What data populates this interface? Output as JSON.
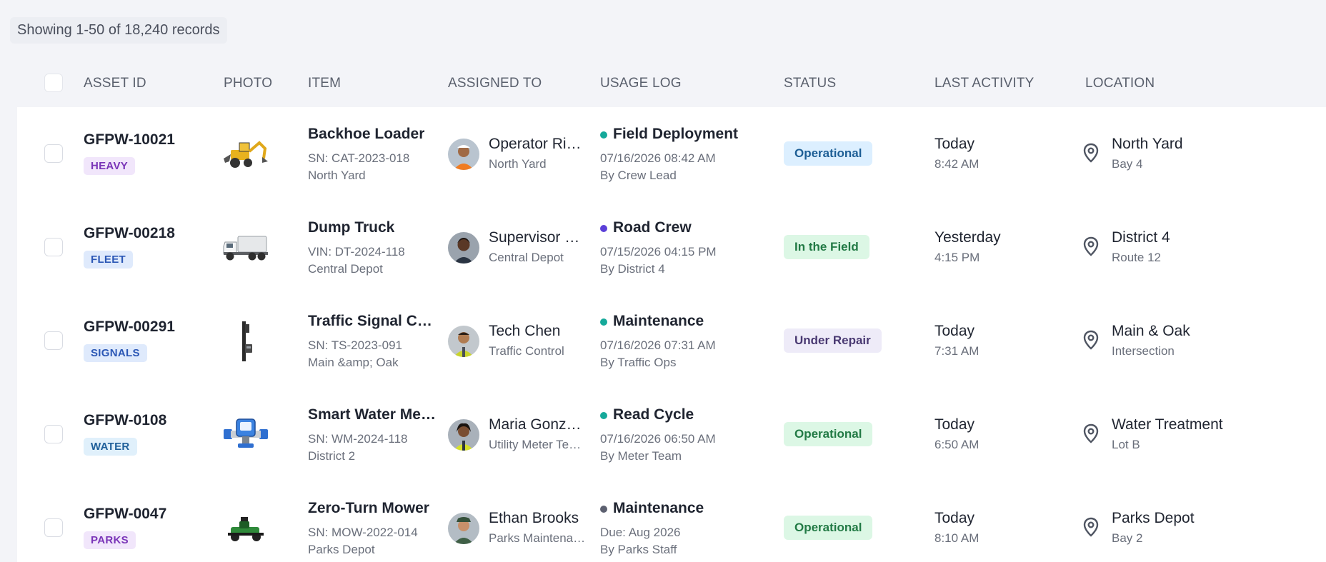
{
  "summary": {
    "records_text": "Showing 1-50 of 18,240 records"
  },
  "columns": {
    "asset_id": "ASSET ID",
    "photo": "PHOTO",
    "item": "ITEM",
    "assigned_to": "ASSIGNED TO",
    "usage_log": "USAGE LOG",
    "status": "STATUS",
    "last_activity": "LAST ACTIVITY",
    "location": "LOCATION"
  },
  "colors": {
    "dot_teal": "#15a99a",
    "dot_purple": "#5b3fd8",
    "dot_gray": "#5c6070"
  },
  "rows": [
    {
      "asset_id": "GFPW-10021",
      "tag": "HEAVY",
      "photo_icon": "backhoe-loader-icon",
      "item_title": "Backhoe Loader",
      "item_sub1": "SN: CAT-2023-018",
      "item_sub2": "North Yard",
      "assignee_name": "Operator Rivera",
      "assignee_sub": "North Yard",
      "log_title": "Field Deployment",
      "log_sub1": "07/16/2026 08:42 AM",
      "log_sub2": "By Crew Lead",
      "status": "Operational",
      "activity_main": "Today",
      "activity_sub": "8:42 AM",
      "location_main": "North Yard",
      "location_sub": "Bay 4"
    },
    {
      "asset_id": "GFPW-00218",
      "tag": "FLEET",
      "photo_icon": "dump-truck-icon",
      "item_title": "Dump Truck",
      "item_sub1": "VIN: DT-2024-118",
      "item_sub2": "Central Depot",
      "assignee_name": "Supervisor Johnson",
      "assignee_sub": "Central Depot",
      "log_title": "Road Crew",
      "log_sub1": "07/15/2026 04:15 PM",
      "log_sub2": "By District 4",
      "status": "In the Field",
      "activity_main": "Yesterday",
      "activity_sub": "4:15 PM",
      "location_main": "District 4",
      "location_sub": "Route 12"
    },
    {
      "asset_id": "GFPW-00291",
      "tag": "SIGNALS",
      "photo_icon": "traffic-signal-icon",
      "item_title": "Traffic Signal Controller",
      "item_sub1": "SN: TS-2023-091",
      "item_sub2": "Main &amp; Oak",
      "assignee_name": "Tech Chen",
      "assignee_sub": "Traffic Control",
      "log_title": "Maintenance",
      "log_sub1": "07/16/2026 07:31 AM",
      "log_sub2": "By Traffic Ops",
      "status": "Under Repair",
      "activity_main": "Today",
      "activity_sub": "7:31 AM",
      "location_main": "Main & Oak",
      "location_sub": "Intersection"
    },
    {
      "asset_id": "GFPW-0108",
      "tag": "WATER",
      "photo_icon": "water-meter-icon",
      "item_title": "Smart Water Meter",
      "item_sub1": "SN: WM-2024-118",
      "item_sub2": "District 2",
      "assignee_name": "Maria Gonzalez",
      "assignee_sub": "Utility Meter Technician",
      "log_title": "Read Cycle",
      "log_sub1": "07/16/2026 06:50 AM",
      "log_sub2": "By Meter Team",
      "status": "Operational",
      "activity_main": "Today",
      "activity_sub": "6:50 AM",
      "location_main": "Water Treatment",
      "location_sub": "Lot B"
    },
    {
      "asset_id": "GFPW-0047",
      "tag": "PARKS",
      "photo_icon": "zero-turn-mower-icon",
      "item_title": "Zero-Turn Mower",
      "item_sub1": "SN: MOW-2022-014",
      "item_sub2": "Parks Depot",
      "assignee_name": "Ethan Brooks",
      "assignee_sub": "Parks Maintenance",
      "log_title": "Maintenance",
      "log_sub1": "Due: Aug 2026",
      "log_sub2": "By Parks Staff",
      "status": "Operational",
      "activity_main": "Today",
      "activity_sub": "8:10 AM",
      "location_main": "Parks Depot",
      "location_sub": "Bay 2"
    }
  ]
}
